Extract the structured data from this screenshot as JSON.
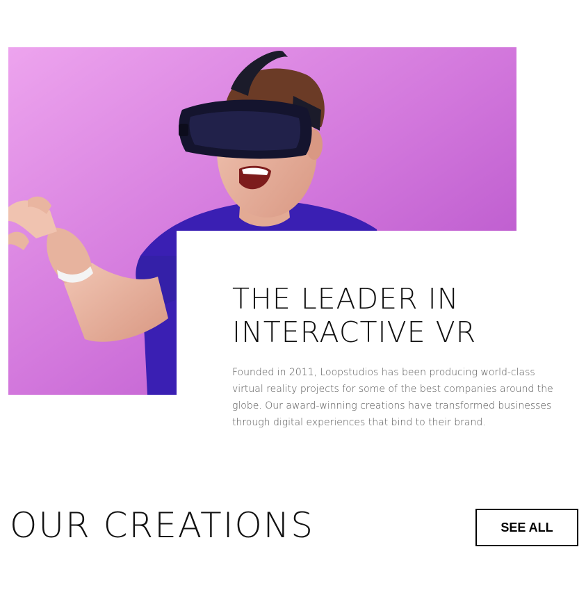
{
  "about": {
    "image_description": "man-wearing-vr-headset",
    "headline_line1": "THE LEADER IN",
    "headline_line2": "INTERACTIVE VR",
    "body": "Founded in 2011, Loopstudios has been producing world-class virtual reality projects for some of the best companies around the globe. Our award-winning creations have transformed businesses through digital experiences that bind to their brand."
  },
  "creations": {
    "title": "OUR CREATIONS",
    "see_all_label": "SEE ALL"
  },
  "colors": {
    "background": "#ffffff",
    "text": "#111111",
    "hero_purple": "#c462d2",
    "shirt_blue": "#3a1fb3"
  }
}
